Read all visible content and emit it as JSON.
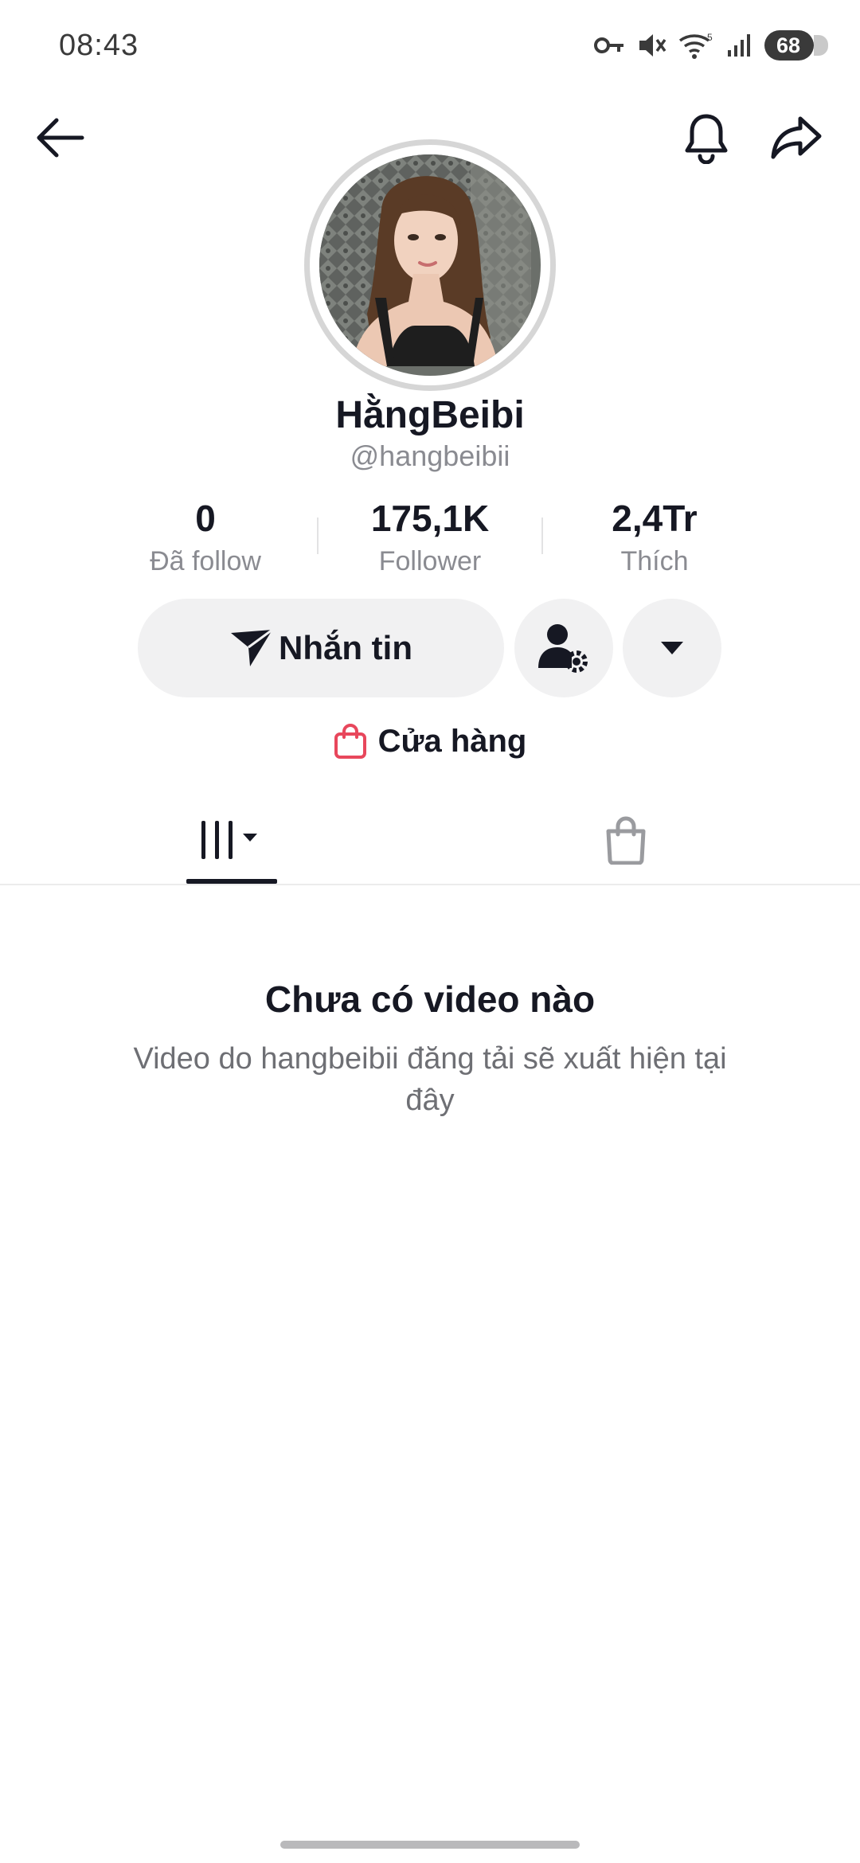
{
  "status_bar": {
    "time": "08:43",
    "battery": "68",
    "icons": [
      "vpn-key-icon",
      "mute-icon",
      "wifi-icon",
      "signal-icon",
      "battery-icon"
    ]
  },
  "nav": {
    "icons": [
      "back-arrow-icon",
      "bell-icon",
      "share-icon"
    ]
  },
  "profile": {
    "display_name": "HằngBeibi",
    "username": "@hangbeibii",
    "avatar_icon": "avatar-photo"
  },
  "stats": [
    {
      "value": "0",
      "label": "Đã follow"
    },
    {
      "value": "175,1K",
      "label": "Follower"
    },
    {
      "value": "2,4Tr",
      "label": "Thích"
    }
  ],
  "actions": {
    "message_label": "Nhắn tin",
    "message_icon": "send-icon",
    "add_friend_icon": "user-settings-icon",
    "more_icon": "caret-down-icon"
  },
  "shop": {
    "label": "Cửa hàng",
    "icon": "shopping-bag-icon",
    "icon_color": "#e8475c"
  },
  "tabs": [
    {
      "name": "videos",
      "icon": "grid-columns-icon",
      "active": true
    },
    {
      "name": "shop",
      "icon": "shopping-bag-icon",
      "active": false
    }
  ],
  "empty_state": {
    "title": "Chưa có video nào",
    "description": "Video do hangbeibii đăng tải sẽ xuất hiện tại đây"
  },
  "colors": {
    "text": "#161823",
    "secondary_text": "#8a8b91",
    "button_bg": "#f1f1f2",
    "accent": "#e8475c"
  }
}
